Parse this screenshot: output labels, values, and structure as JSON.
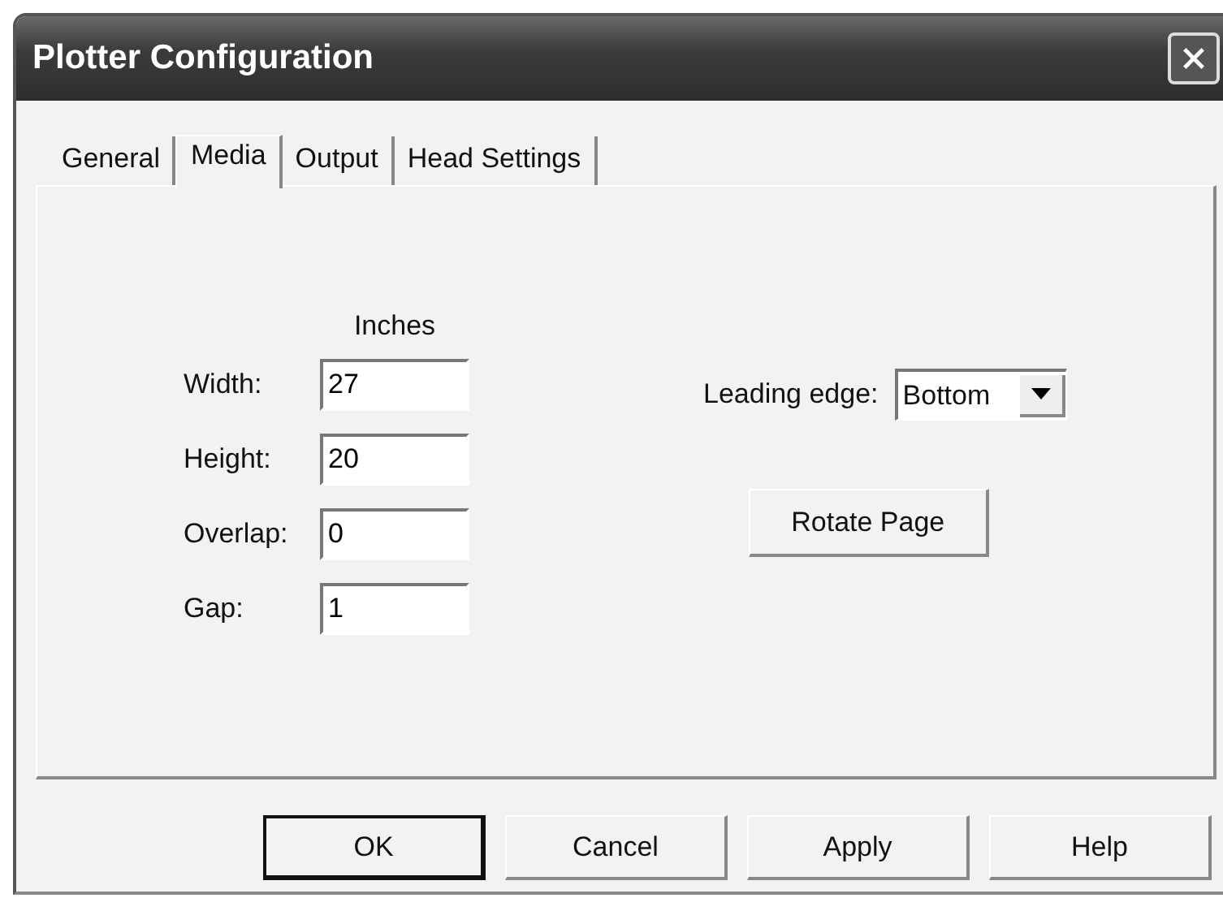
{
  "window": {
    "title": "Plotter Configuration"
  },
  "tabs": [
    {
      "label": "General",
      "selected": false
    },
    {
      "label": "Media",
      "selected": true
    },
    {
      "label": "Output",
      "selected": false
    },
    {
      "label": "Head Settings",
      "selected": false
    }
  ],
  "units_label": "Inches",
  "fields": [
    {
      "label": "Width:",
      "value": "27"
    },
    {
      "label": "Height:",
      "value": "20"
    },
    {
      "label": "Overlap:",
      "value": "0"
    },
    {
      "label": "Gap:",
      "value": "1"
    }
  ],
  "leading_edge": {
    "label": "Leading edge:",
    "value": "Bottom"
  },
  "rotate_button": "Rotate Page",
  "buttons": [
    {
      "label": "OK",
      "default": true
    },
    {
      "label": "Cancel",
      "default": false
    },
    {
      "label": "Apply",
      "default": false
    },
    {
      "label": "Help",
      "default": false
    }
  ]
}
